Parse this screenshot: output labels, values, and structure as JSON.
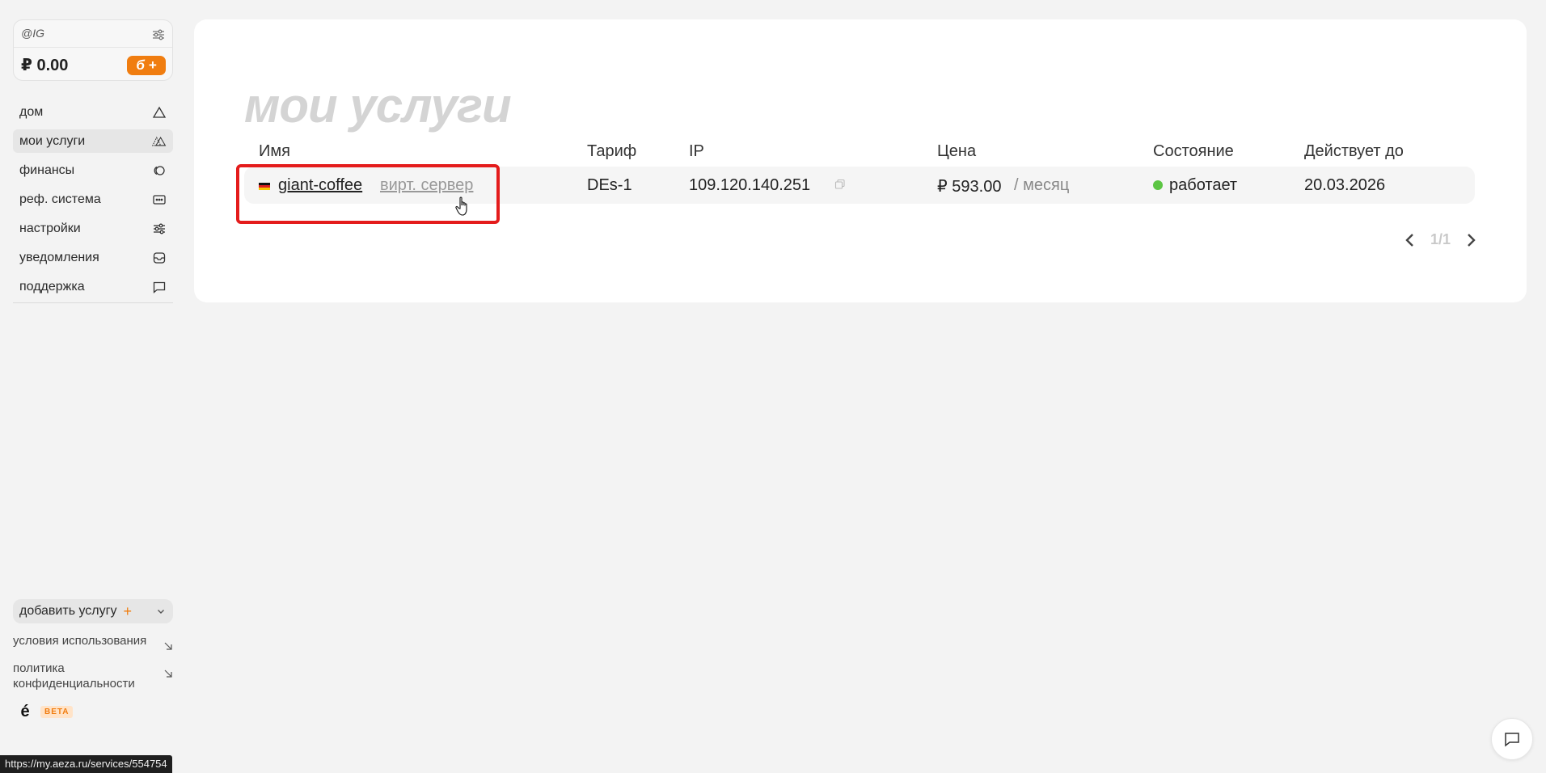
{
  "account": {
    "handle": "@IG",
    "balance": "₽ 0.00",
    "topup_label": "б +"
  },
  "nav": {
    "items": [
      {
        "label": "дом",
        "icon": "home-triangle-icon"
      },
      {
        "label": "мои услуги",
        "icon": "services-icon",
        "active": true
      },
      {
        "label": "финансы",
        "icon": "finance-icon"
      },
      {
        "label": "реф. система",
        "icon": "referral-icon"
      },
      {
        "label": "настройки",
        "icon": "settings-icon"
      },
      {
        "label": "уведомления",
        "icon": "inbox-icon"
      },
      {
        "label": "поддержка",
        "icon": "chat-icon"
      }
    ]
  },
  "sidebar_bottom": {
    "add_service": "добавить услугу",
    "add_plus": "+",
    "terms": "условия использования",
    "privacy": "политика конфиденциальности",
    "logo_mark": "é",
    "beta": "BETA"
  },
  "main": {
    "title": "мои услуги",
    "columns": [
      "Имя",
      "Тариф",
      "IP",
      "Цена",
      "Состояние",
      "Действует до"
    ],
    "rows": [
      {
        "name": "giant-coffee",
        "type": "вирт. сервер",
        "tariff": "DEs-1",
        "ip": "109.120.140.251",
        "price": "₽ 593.00",
        "period": "/ месяц",
        "status": "работает",
        "valid_until": "20.03.2026"
      }
    ],
    "pager": "1/1"
  },
  "status_url": "https://my.aeza.ru/services/554754",
  "colors": {
    "accent": "#f07d10",
    "status_ok": "#5cc543",
    "highlight": "#e41c1c"
  }
}
